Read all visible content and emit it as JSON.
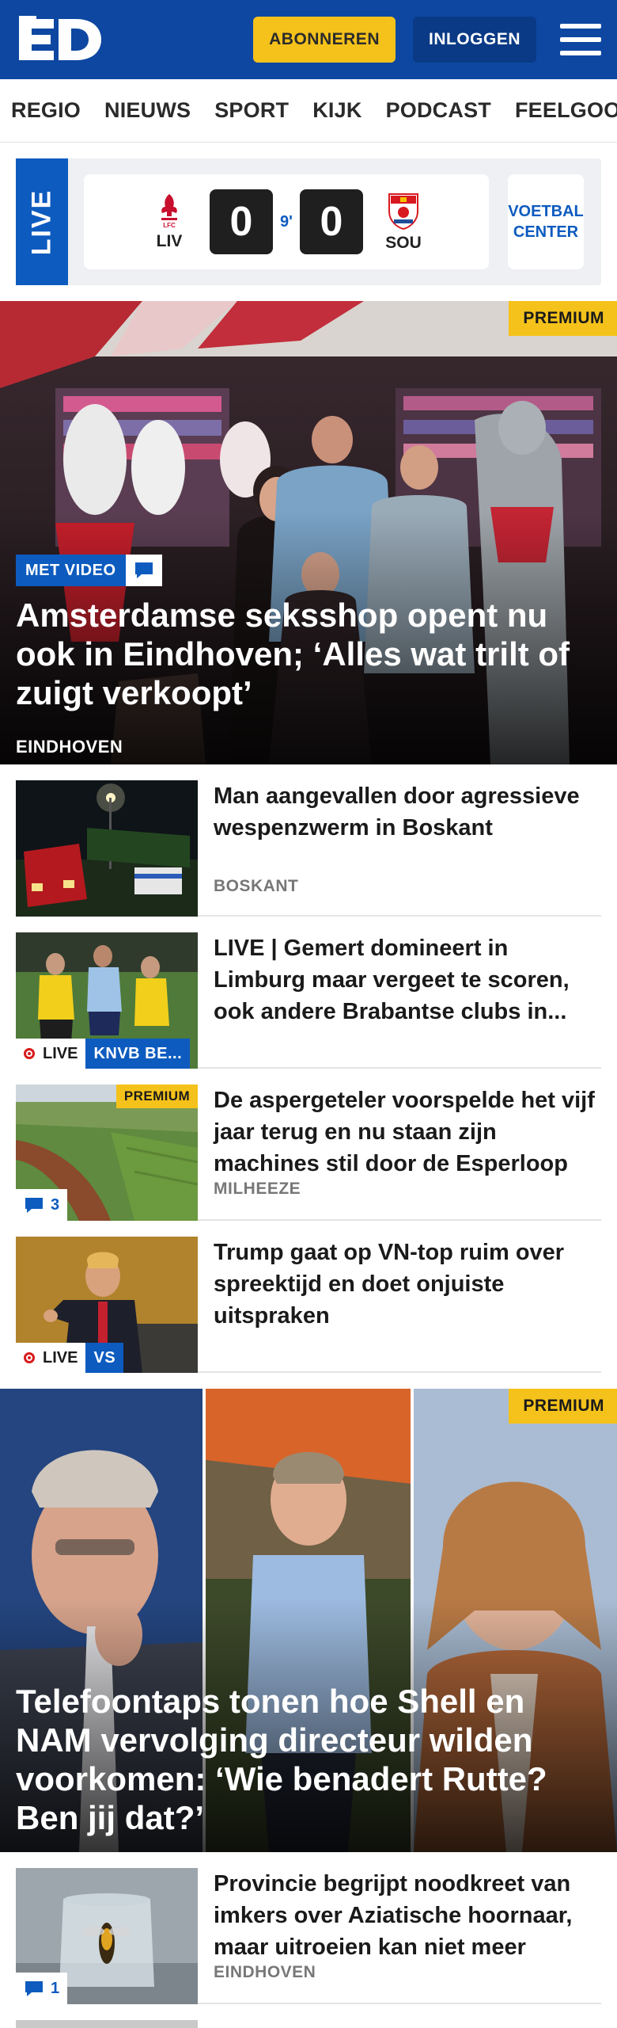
{
  "header": {
    "logo_text": "ED",
    "subscribe_label": "ABONNEREN",
    "login_label": "INLOGGEN"
  },
  "nav": {
    "items": [
      "REGIO",
      "NIEUWS",
      "SPORT",
      "KIJK",
      "PODCAST",
      "FEELGOOD"
    ]
  },
  "live_widget": {
    "live_label": "LIVE",
    "home_team": "LIV",
    "home_score": "0",
    "minute": "9'",
    "away_score": "0",
    "away_team": "SOU",
    "center_label_1": "VOETBAL",
    "center_label_2": "CENTER"
  },
  "hero": {
    "premium_label": "PREMIUM",
    "video_label": "MET VIDEO",
    "title": "Amsterdamse seksshop opent nu ook in Eindhoven; ‘Alles wat trilt of zuigt verkoopt’",
    "location": "EINDHOVEN"
  },
  "articles": [
    {
      "title": "Man aangevallen door agressieve wespenzwerm in Boskant",
      "location": "BOSKANT"
    },
    {
      "title": "LIVE | Gemert domineert in Limburg maar vergeet te scoren, ook andere Brabantse clubs in...",
      "live_label": "LIVE",
      "tag": "KNVB BE..."
    },
    {
      "title": "De aspergeteler voorspelde het vijf jaar terug en nu staan zijn machines stil door de Esperloop",
      "location": "MILHEEZE",
      "premium_label": "PREMIUM",
      "comments": "3"
    },
    {
      "title": "Trump gaat op VN-top ruim over spreektijd en doet onjuiste uitspraken",
      "live_label": "LIVE",
      "tag": "VS"
    }
  ],
  "hero2": {
    "premium_label": "PREMIUM",
    "title": "Telefoontaps tonen hoe Shell en NAM vervolging directeur wilden voorkomen: ‘Wie benadert Rutte? Ben jij dat?’"
  },
  "articles2": [
    {
      "title": "Provincie begrijpt noodkreet van imkers over Aziatische hoornaar, maar uitroeien kan niet meer",
      "location": "EINDHOVEN",
      "comments": "1"
    }
  ],
  "colors": {
    "brand_blue": "#0d47a1",
    "accent_yellow": "#f5c21b",
    "live_blue": "#0d5bbf"
  }
}
